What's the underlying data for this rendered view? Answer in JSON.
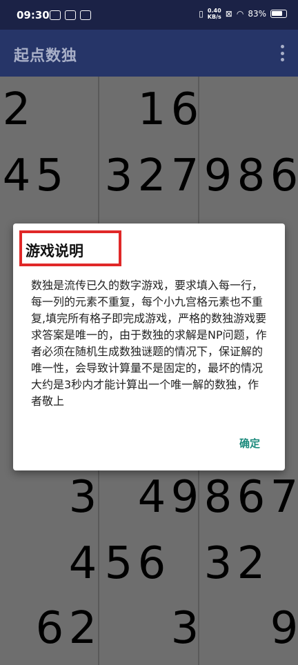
{
  "status_bar": {
    "time": "09:30",
    "net_speed_value": "0.40",
    "net_speed_unit": "KB/s",
    "battery": "83%"
  },
  "app_bar": {
    "title": "起点数独"
  },
  "board": {
    "rows": [
      [
        "2",
        "",
        "",
        "",
        "1",
        "6",
        "",
        "",
        ""
      ],
      [
        "4",
        "5",
        "",
        "3",
        "2",
        "7",
        "9",
        "8",
        "6"
      ],
      [
        "",
        "",
        "",
        "",
        "",
        "",
        "",
        "",
        ""
      ],
      [
        "",
        "",
        "",
        "",
        "",
        "",
        "",
        "",
        ""
      ],
      [
        "",
        "",
        "",
        "",
        "",
        "",
        "",
        "",
        ""
      ],
      [
        "",
        "",
        "",
        "",
        "",
        "",
        "",
        "",
        ""
      ],
      [
        "",
        "",
        "3",
        "",
        "4",
        "9",
        "8",
        "6",
        "7"
      ],
      [
        "",
        "",
        "4",
        "5",
        "6",
        "",
        "3",
        "2",
        ""
      ],
      [
        "",
        "6",
        "2",
        "",
        "",
        "3",
        "",
        "",
        "9"
      ]
    ]
  },
  "dialog": {
    "title": "游戏说明",
    "body": "数独是流传已久的数字游戏，要求填入每一行，每一列的元素不重复，每个小九宫格元素也不重复,填完所有格子即完成游戏，严格的数独游戏要求答案是唯一的，由于数独的求解是NP问题，作者必须在随机生成数独谜题的情况下，保证解的唯一性，会导致计算量不是固定的，最坏的情况大约是3秒内才能计算出一个唯一解的数独，作者敬上",
    "ok_label": "确定"
  }
}
